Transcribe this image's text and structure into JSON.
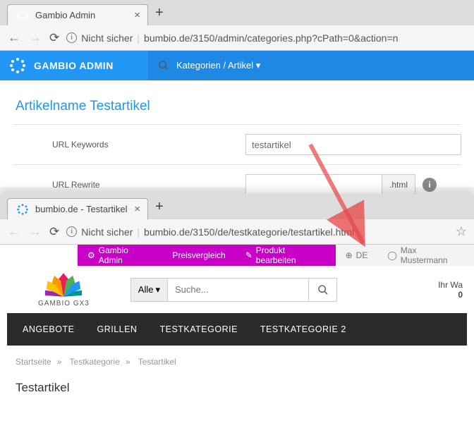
{
  "b1": {
    "tab_title": "Gambio Admin",
    "not_secure": "Nicht sicher",
    "url": "bumbio.de/3150/admin/categories.php?cPath=0&action=n",
    "brand": "GAMBIO ADMIN",
    "crumb": "Kategorien / Artikel ▾",
    "article_title": "Artikelname Testartikel",
    "url_keywords_label": "URL Keywords",
    "url_keywords_value": "testartikel",
    "url_rewrite_label": "URL Rewrite",
    "url_rewrite_value": "",
    "suffix": ".html"
  },
  "b2": {
    "tab_title": "bumbio.de - Testartikel",
    "not_secure": "Nicht sicher",
    "url": "bumbio.de/3150/de/testkategorie/testartikel.html",
    "topbar": {
      "admin": "Gambio Admin",
      "compare": "Preisvergleich",
      "edit": "Produkt bearbeiten",
      "lang": "DE",
      "user": "Max Mustermann"
    },
    "logo_text": "GAMBIO GX3",
    "search_all": "Alle",
    "search_placeholder": "Suche...",
    "cart_label": "Ihr Wa",
    "cart_count": "0",
    "nav": [
      "ANGEBOTE",
      "GRILLEN",
      "TESTKATEGORIE",
      "TESTKATEGORIE 2"
    ],
    "crumbs": {
      "home": "Startseite",
      "cat": "Testkategorie",
      "prod": "Testartikel"
    },
    "product_title": "Testartikel"
  }
}
